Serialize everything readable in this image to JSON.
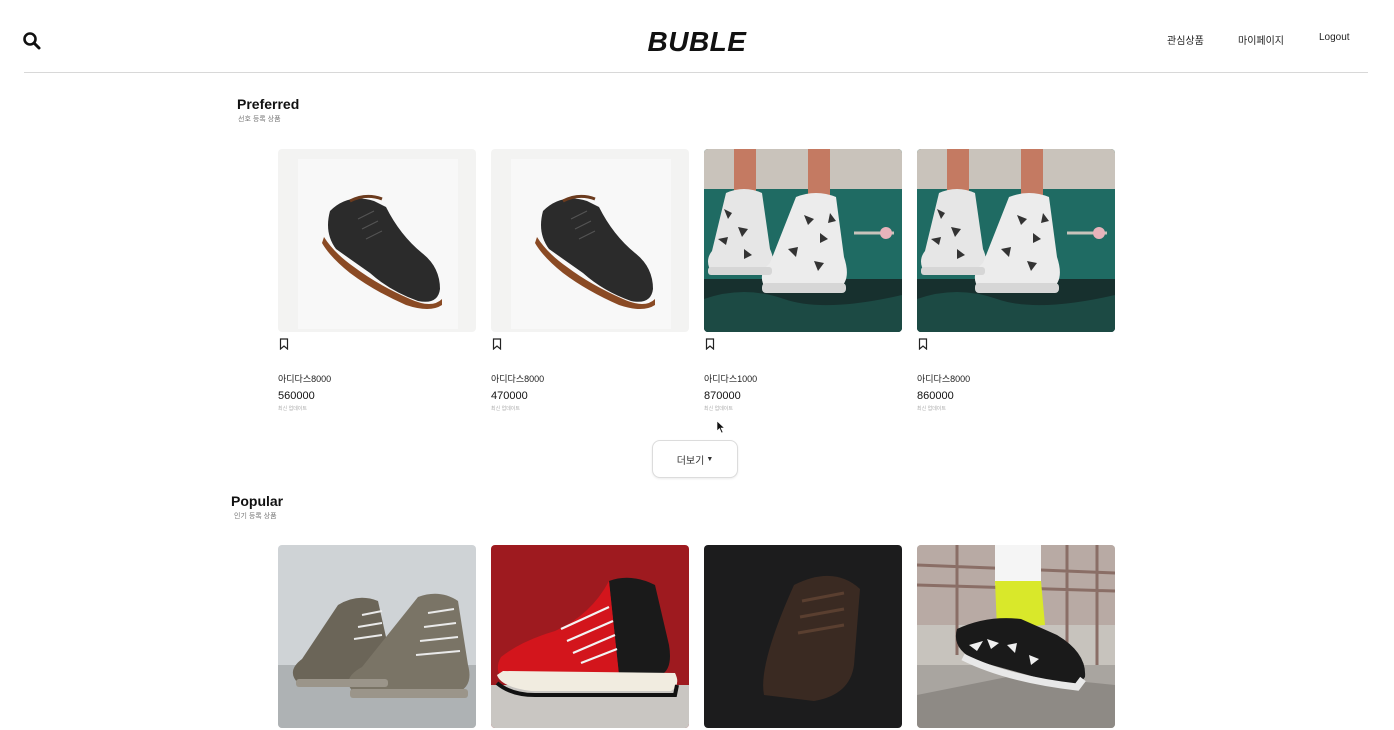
{
  "header": {
    "logo": "BUBLE",
    "search_icon": "search-icon",
    "nav": {
      "wishlist": "관심상품",
      "mypage": "마이페이지",
      "logout": "Logout"
    }
  },
  "preferred": {
    "title": "Preferred",
    "subtitle": "선호 등록 상품",
    "more_label": "더보기",
    "more_icon": "caret-down-icon",
    "items": [
      {
        "name": "아디다스8000",
        "price": "560000",
        "note": "최신 업데이트",
        "image": "dark-leather-boot"
      },
      {
        "name": "아디다스8000",
        "price": "470000",
        "note": "최신 업데이트",
        "image": "dark-leather-boot"
      },
      {
        "name": "아디다스1000",
        "price": "870000",
        "note": "최신 업데이트",
        "image": "camo-platform-boots"
      },
      {
        "name": "아디다스8000",
        "price": "860000",
        "note": "최신 업데이트",
        "image": "camo-platform-boots"
      }
    ]
  },
  "popular": {
    "title": "Popular",
    "subtitle": "인기 등록 상품",
    "items": [
      {
        "image": "grey-high-top-sneakers"
      },
      {
        "image": "red-black-high-top-sneaker"
      },
      {
        "image": "brown-boot-dark"
      },
      {
        "image": "black-yellow-runner"
      }
    ]
  },
  "colors": {
    "background": "#ffffff",
    "text": "#111111",
    "divider": "#d8d8d8",
    "camo_bg": "#1f6b63",
    "sneaker_red": "#c8161d"
  }
}
